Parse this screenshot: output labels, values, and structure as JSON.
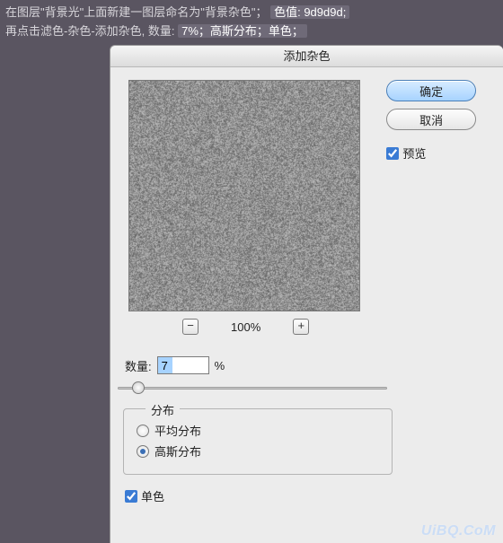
{
  "header": {
    "line1a": "在图层\"背景光\"上面新建一图层命名为\"背景杂色\"；",
    "line1b": "色值: 9d9d9d;",
    "line2a": "再点击滤色-杂色-添加杂色, 数量:",
    "line2b": "7%；高斯分布；单色；"
  },
  "dialog": {
    "title": "添加杂色",
    "buttons": {
      "ok": "确定",
      "cancel": "取消"
    },
    "preview_label": "预览",
    "preview_checked": true,
    "zoom": {
      "level": "100%",
      "minus": "−",
      "plus": "+"
    },
    "amount": {
      "label": "数量:",
      "value": "7",
      "unit": "%"
    },
    "distribution": {
      "legend": "分布",
      "uniform": "平均分布",
      "gaussian": "高斯分布",
      "selected": "gaussian"
    },
    "mono": {
      "label": "单色",
      "checked": true
    }
  },
  "watermark": "UiBQ.CoM"
}
